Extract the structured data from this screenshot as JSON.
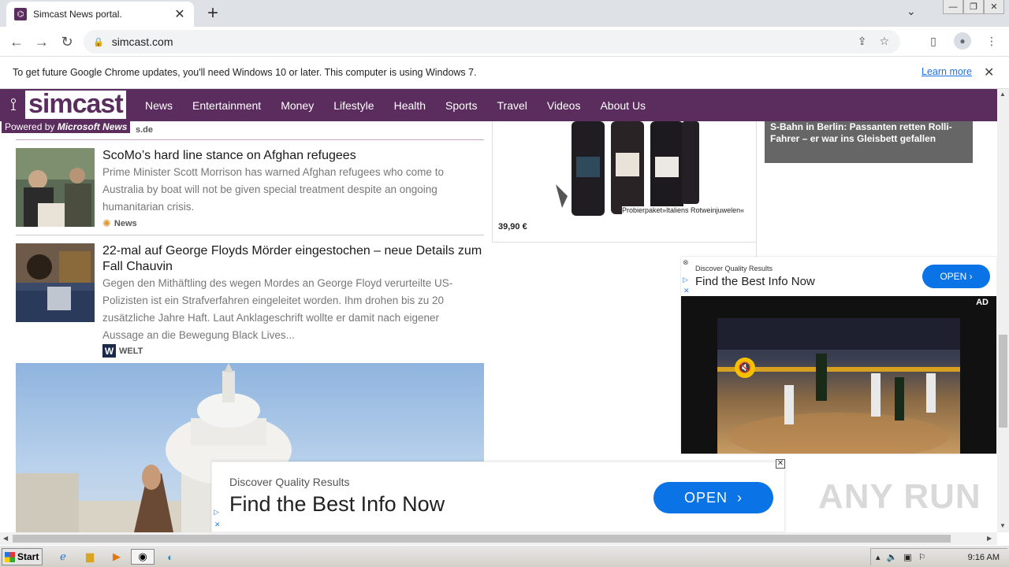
{
  "browser": {
    "tab_title": "Simcast News portal.",
    "url": "simcast.com",
    "infobar_text": "To get future Google Chrome updates, you'll need Windows 10 or later. This computer is using Windows 7.",
    "learn_more": "Learn more"
  },
  "site": {
    "logo_text": "simcast",
    "powered_prefix": "Powered by ",
    "powered_brand": "Microsoft News",
    "nav": [
      "News",
      "Entertainment",
      "Money",
      "Lifestyle",
      "Health",
      "Sports",
      "Travel",
      "Videos",
      "About Us"
    ]
  },
  "feed": {
    "top_source_fragment": "s.de",
    "articles": [
      {
        "title": "ScoMo’s hard line stance on Afghan refugees",
        "desc": "Prime Minister Scott Morrison has warned Afghan refugees who come to Australia by boat will not be given special treatment despite an ongoing humanitarian crisis.",
        "source": "News"
      },
      {
        "title": "22-mal auf George Floyds Mörder eingestochen – neue Details zum Fall Chauvin",
        "desc": "Gegen den Mithäftling des wegen Mordes an George Floyd verurteilte US-Polizisten ist ein Strafverfahren eingeleitet worden. Ihm drohen bis zu 20 zusätzliche Jahre Haft. Laut Anklageschrift wollte er damit nach eigener Aussage an die Bewegung Black Lives...",
        "source": "WELT",
        "source_logo": "W"
      }
    ]
  },
  "product_ad": {
    "price": "39,90 €",
    "name": "Probierpaket»Italiens Rotweinjuwelen«"
  },
  "right_card": {
    "headline": "S-Bahn in Berlin: Passanten retten Rolli-Fahrer – er war ins Gleisbett gefallen"
  },
  "video_ad": {
    "small": "Discover Quality Results",
    "big": "Find the Best Info Now",
    "open": "OPEN",
    "ad_tag": "AD"
  },
  "bottom_ad": {
    "small": "Discover Quality Results",
    "big": "Find the Best Info Now",
    "open": "OPEN"
  },
  "watermark": "ANY RUN",
  "taskbar": {
    "start": "Start",
    "clock": "9:16 AM"
  }
}
